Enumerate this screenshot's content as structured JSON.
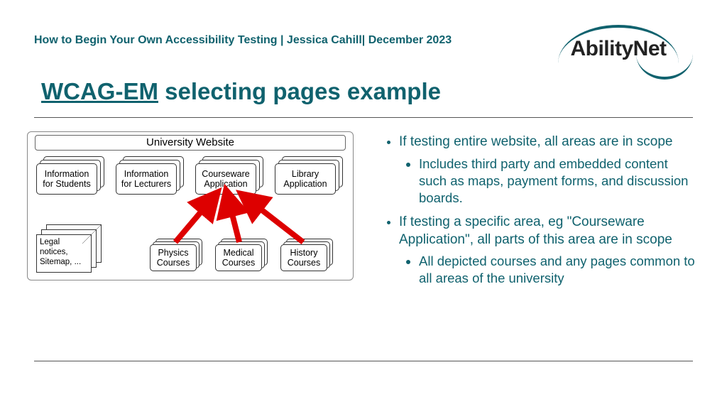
{
  "header": {
    "breadcrumb": "How to Begin Your Own Accessibility Testing | Jessica Cahill| December 2023"
  },
  "logo": {
    "text": "AbilityNet"
  },
  "title": {
    "link_text": "WCAG-EM",
    "rest": " selecting pages example"
  },
  "diagram": {
    "container_label": "University Website",
    "row1": [
      "Information for Students",
      "Information for Lecturers",
      "Courseware Application",
      "Library Application"
    ],
    "row2": [
      "Physics Courses",
      "Medical Courses",
      "History Courses"
    ],
    "legal_label": "Legal notices, Sitemap, ..."
  },
  "bullets": {
    "b1": "If testing entire website, all areas are in scope",
    "b1a": "Includes third party and embedded content such as maps, payment forms, and discussion boards.",
    "b2": "If testing a specific area, eg \"Courseware Application\", all parts of this area are in scope",
    "b2a": "All depicted courses and any pages common to all areas of the university"
  }
}
